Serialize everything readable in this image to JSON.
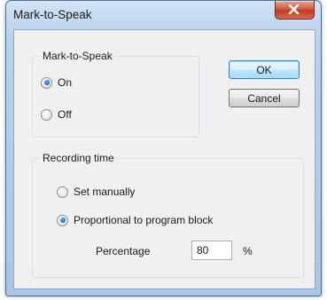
{
  "window": {
    "title": "Mark-to-Speak",
    "close_icon": "close-icon"
  },
  "mark_group": {
    "legend": "Mark-to-Speak",
    "options": [
      {
        "label": "On",
        "checked": true
      },
      {
        "label": "Off",
        "checked": false
      }
    ]
  },
  "buttons": {
    "ok": "OK",
    "cancel": "Cancel"
  },
  "recording_group": {
    "legend": "Recording time",
    "options": [
      {
        "label": "Set manually",
        "checked": false
      },
      {
        "label": "Proportional to program block",
        "checked": true
      }
    ],
    "percentage_label": "Percentage",
    "percentage_value": "80",
    "percent_unit": "%"
  }
}
